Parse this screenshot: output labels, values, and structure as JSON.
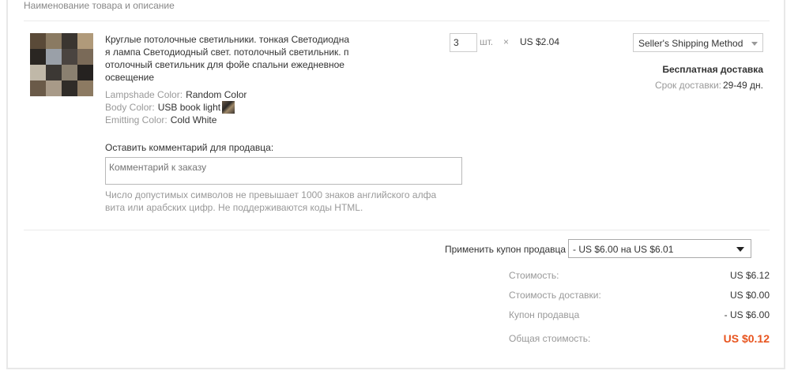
{
  "header": {
    "title": "Наименование товара и описание"
  },
  "item": {
    "title": "Круглые потолочные светильники. тонкая Светодиодная лампа Светодиодный свет. потолочный светильник. потолочный светильник для фойе спальни ежедневное освещение",
    "props": [
      {
        "key": "Lampshade Color:",
        "value": "Random Color"
      },
      {
        "key": "Body Color:",
        "value": "USB book light"
      },
      {
        "key": "Emitting Color:",
        "value": "Cold White"
      }
    ],
    "quantity": "3",
    "unit": "шт.",
    "times": "×",
    "unit_price": "US $2.04",
    "shipping_method": "Seller's Shipping Method",
    "free_shipping": "Бесплатная доставка",
    "delivery_label": "Срок доставки:",
    "delivery_value": "29-49 дн."
  },
  "comment": {
    "label": "Оставить комментарий для продавца:",
    "placeholder": "Комментарий к заказу",
    "note": "Число допустимых символов не превышает 1000 знаков английского алфавита или арабских цифр. Не поддерживаются коды HTML."
  },
  "coupon": {
    "label": "Применить купон продавца",
    "selected": "- US $6.00 на US $6.01"
  },
  "summary": {
    "cost_label": "Стоимость:",
    "cost_value": "US $6.12",
    "shipping_label": "Стоимость доставки:",
    "shipping_value": "US $0.00",
    "coupon_label": "Купон продавца",
    "coupon_value": "- US $6.00",
    "total_label": "Общая стоимость:",
    "total_value": "US $0.12"
  },
  "colors": {
    "accent": "#e8541e",
    "muted": "#999999",
    "border": "#e8e8e8"
  },
  "icons": {
    "dropdown": "chevron-down-icon"
  }
}
